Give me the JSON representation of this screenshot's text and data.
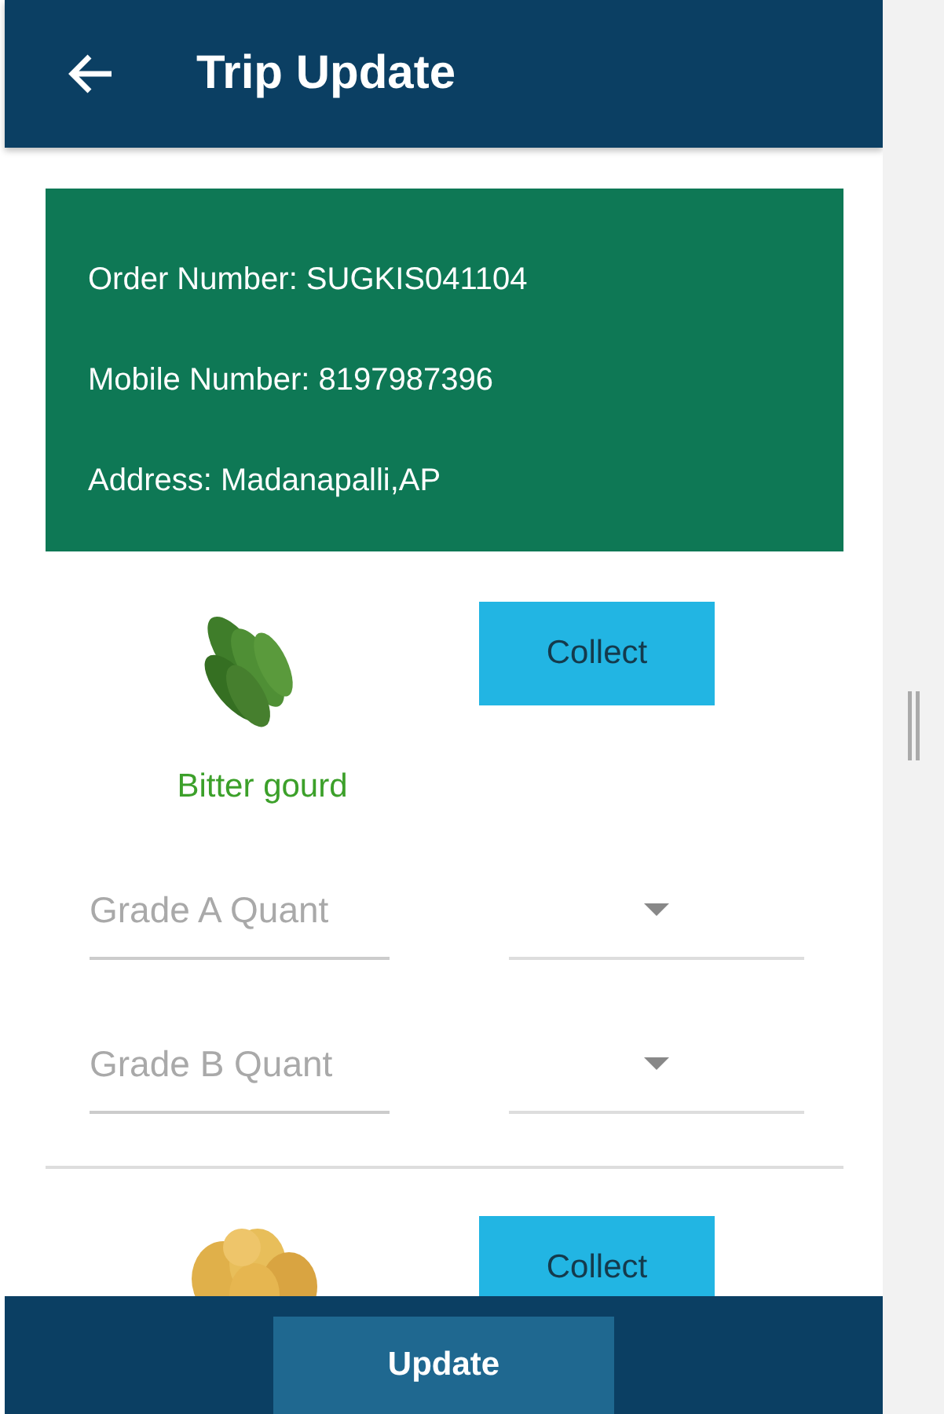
{
  "header": {
    "title": "Trip Update"
  },
  "order_info": [
    "Order Number: SUGKIS041104",
    "Mobile Number: 8197987396",
    "Address: Madanapalli,AP"
  ],
  "items": [
    {
      "kind": "picture",
      "name": "Bitter gourd",
      "button": "Collect",
      "quantities": [
        {
          "placeholder": "Grade A Quant"
        },
        {
          "placeholder": "Grade B Quant"
        }
      ]
    },
    {
      "kind": "picture",
      "button": "Collect"
    }
  ],
  "footer": {
    "button": "Update"
  }
}
